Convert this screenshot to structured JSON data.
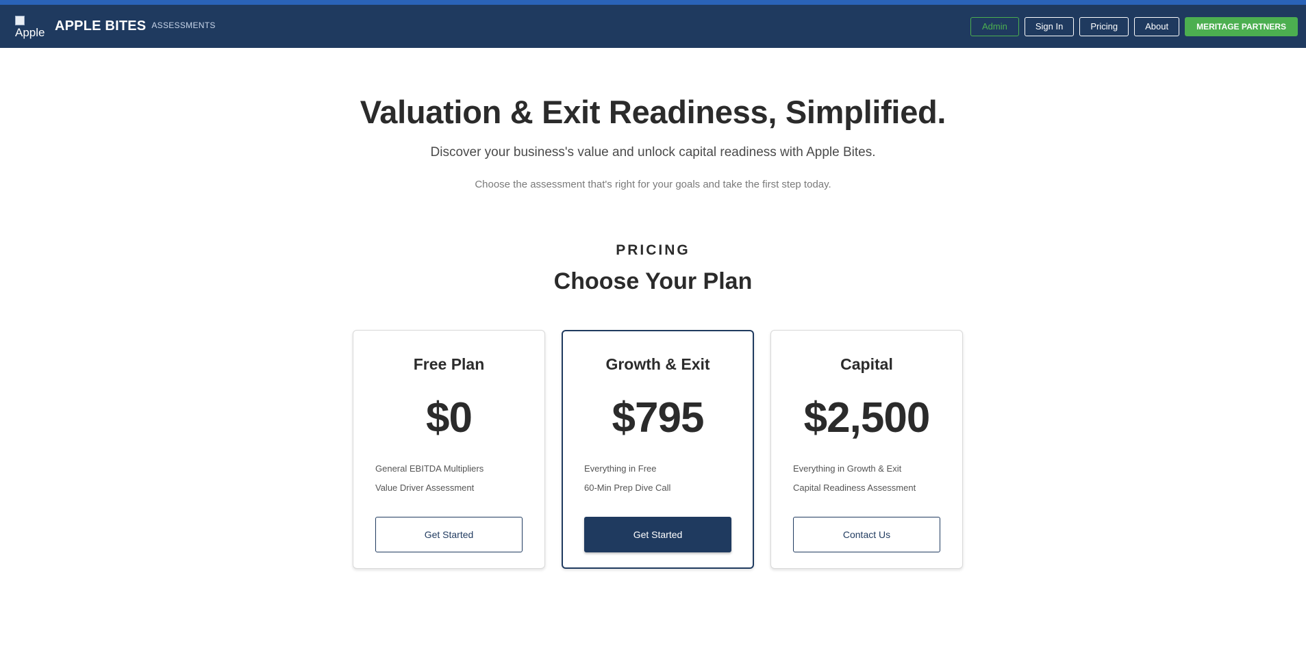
{
  "navbar": {
    "logo_alt": "Apple",
    "brand": "APPLE BITES",
    "brand_sub": "ASSESSMENTS",
    "links": {
      "admin": "Admin",
      "sign_in": "Sign In",
      "pricing": "Pricing",
      "about": "About",
      "partners": "MERITAGE PARTNERS"
    }
  },
  "hero": {
    "title": "Valuation & Exit Readiness, Simplified.",
    "subtitle": "Discover your business's value and unlock capital readiness with Apple Bites.",
    "tagline": "Choose the assessment that's right for your goals and take the first step today."
  },
  "pricing": {
    "eyebrow": "PRICING",
    "heading": "Choose Your Plan",
    "plans": [
      {
        "name": "Free Plan",
        "price": "$0",
        "features": [
          "General EBITDA Multipliers",
          "Value Driver Assessment"
        ],
        "cta": "Get Started"
      },
      {
        "name": "Growth & Exit",
        "price": "$795",
        "features": [
          "Everything in Free",
          "60-Min Prep Dive Call"
        ],
        "cta": "Get Started"
      },
      {
        "name": "Capital",
        "price": "$2,500",
        "features": [
          "Everything in Growth & Exit",
          "Capital Readiness Assessment"
        ],
        "cta": "Contact Us"
      }
    ]
  },
  "colors": {
    "navbar": "#1f3a5f",
    "accent_green": "#4caf50",
    "top_line": "#2a63b8"
  }
}
